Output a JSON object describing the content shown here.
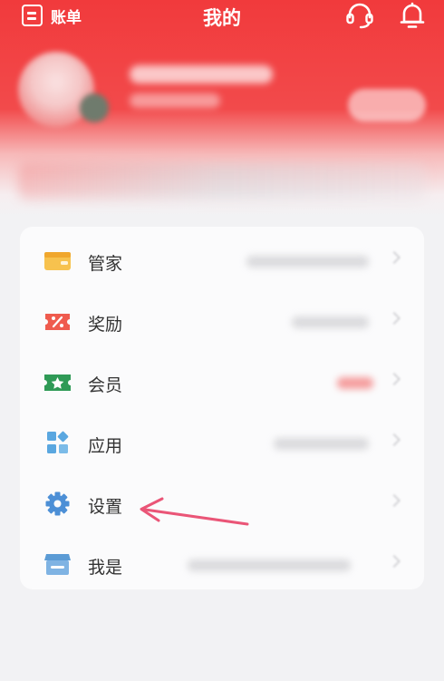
{
  "topbar": {
    "bill_label": "账单",
    "title": "我的",
    "support_icon": "headset-icon",
    "notification_icon": "bell-icon"
  },
  "menu": {
    "items": [
      {
        "label": "管家",
        "icon": "wallet-card-icon",
        "color": "#f5b63b"
      },
      {
        "label": "奖励",
        "icon": "coupon-percent-icon",
        "color": "#ef5b4e"
      },
      {
        "label": "会员",
        "icon": "member-ticket-icon",
        "color": "#2f9a56"
      },
      {
        "label": "应用",
        "icon": "apps-grid-icon",
        "color": "#5aa7e0"
      },
      {
        "label": "设置",
        "icon": "gear-icon",
        "color": "#4c8fd6"
      },
      {
        "label": "我是",
        "icon": "store-icon",
        "color": "#5b9bd5"
      }
    ]
  },
  "colors": {
    "header_red": "#f13a3c",
    "annotation_arrow": "#ea5577"
  }
}
